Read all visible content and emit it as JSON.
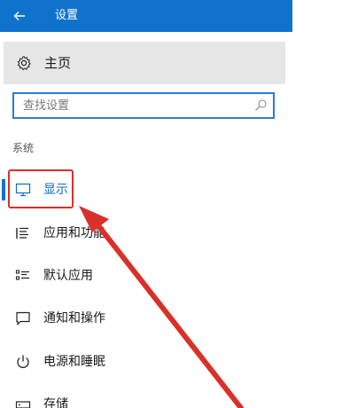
{
  "window": {
    "title": "设置"
  },
  "home": {
    "label": "主页"
  },
  "search": {
    "placeholder": "查找设置"
  },
  "section": {
    "label": "系统"
  },
  "nav": {
    "items": [
      {
        "label": "显示",
        "icon": "monitor-icon",
        "active": true
      },
      {
        "label": "应用和功能",
        "icon": "list-icon",
        "active": false
      },
      {
        "label": "默认应用",
        "icon": "default-apps-icon",
        "active": false
      },
      {
        "label": "通知和操作",
        "icon": "chat-bubble-icon",
        "active": false
      },
      {
        "label": "电源和睡眠",
        "icon": "power-icon",
        "active": false
      },
      {
        "label": "存储",
        "icon": "storage-icon",
        "active": false
      }
    ]
  },
  "colors": {
    "accent": "#0f73cc",
    "annotation": "#d9302a"
  }
}
